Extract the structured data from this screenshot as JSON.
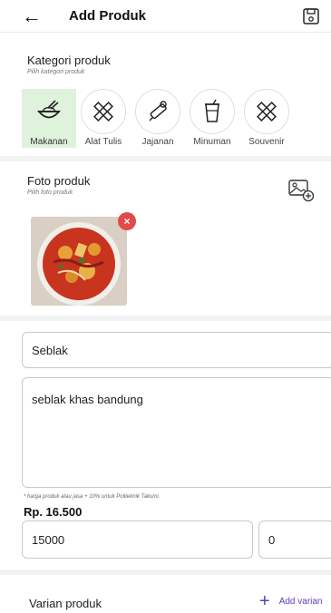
{
  "appbar": {
    "title": "Add Produk",
    "back_icon": "arrow-left-icon",
    "save_icon": "save-icon"
  },
  "kategori": {
    "title": "Kategori produk",
    "subtitle": "Pilih kategori produk",
    "items": [
      {
        "label": "Makanan",
        "icon": "food-bowl-icon",
        "selected": true
      },
      {
        "label": "Alat Tulis",
        "icon": "pencil-ruler-icon",
        "selected": false
      },
      {
        "label": "Jajanan",
        "icon": "snack-icon",
        "selected": false
      },
      {
        "label": "Minuman",
        "icon": "drink-cup-icon",
        "selected": false
      },
      {
        "label": "Souvenir",
        "icon": "souvenir-icon",
        "selected": false
      }
    ]
  },
  "foto": {
    "title": "Foto produk",
    "subtitle": "Pilih foto produk",
    "add_icon": "add-image-icon",
    "remove_label": "×"
  },
  "form": {
    "name_value": "Seblak",
    "description_value": "seblak khas bandung",
    "note": "* harga produk atau jasa + 10% untuk Politeknik Takumi.",
    "price_display": "Rp. 16.500",
    "price_value": "15000",
    "discount_value": "0"
  },
  "varian": {
    "title": "Varian produk",
    "add_label": "Add varian"
  },
  "colors": {
    "accent": "#5d3db8",
    "selected_bg": "#dff2dc",
    "remove": "#e24a4a"
  }
}
